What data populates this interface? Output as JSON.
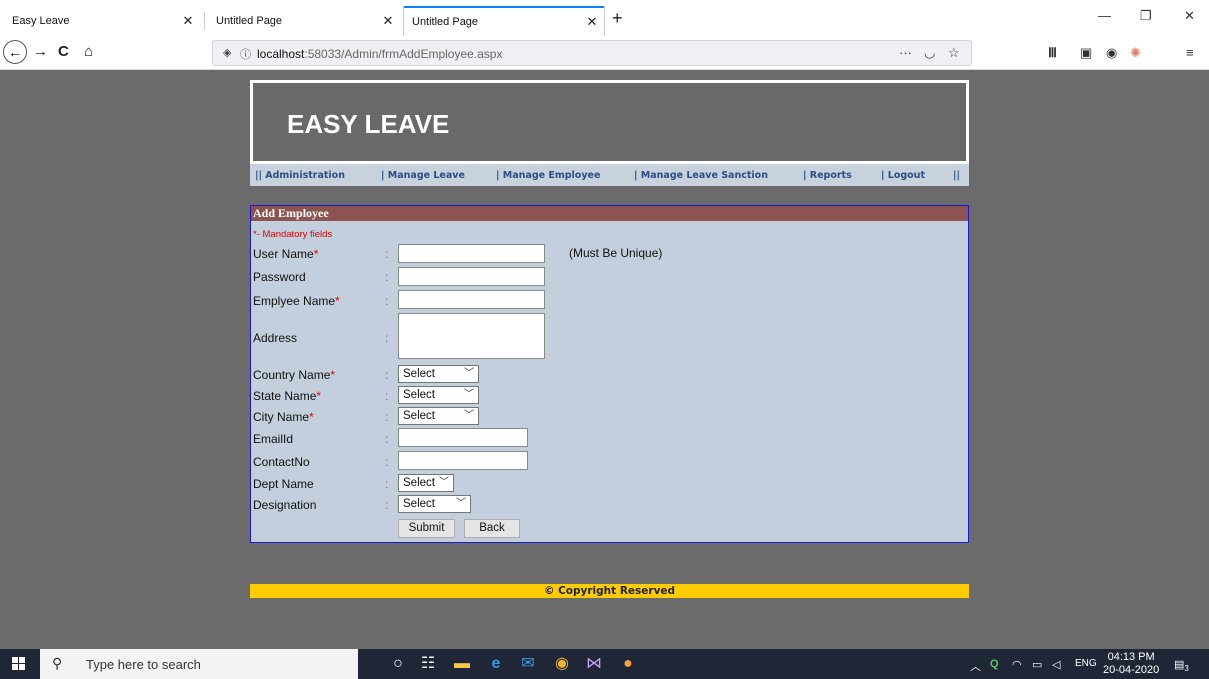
{
  "browser": {
    "tabs": [
      {
        "title": "Easy Leave"
      },
      {
        "title": "Untitled Page"
      },
      {
        "title": "Untitled Page"
      }
    ],
    "url_host": "localhost",
    "url_path": ":58033/Admin/frmAddEmployee.aspx",
    "more_icon": "···"
  },
  "site": {
    "title": "EASY LEAVE",
    "menu": [
      "||   Administration",
      "|   Manage Leave",
      "|   Manage Employee",
      "|   Manage Leave Sanction",
      "|   Reports",
      "|   Logout",
      "||"
    ]
  },
  "form": {
    "header": "Add Employee",
    "mandatory_note": "*- Mandatory fields",
    "colon": ":",
    "unique_note": "(Must Be Unique)",
    "fields": {
      "username": {
        "label": "User Name",
        "req": "*",
        "value": ""
      },
      "password": {
        "label": "Password",
        "value": ""
      },
      "empname": {
        "label": "Emplyee Name",
        "req": "*",
        "value": ""
      },
      "address": {
        "label": "Address",
        "value": ""
      },
      "country": {
        "label": "Country Name",
        "req": "*",
        "selected": "Select"
      },
      "state": {
        "label": "State Name",
        "req": "*",
        "selected": "Select"
      },
      "city": {
        "label": "City Name",
        "req": "*",
        "selected": "Select"
      },
      "email": {
        "label": "EmailId",
        "value": ""
      },
      "contact": {
        "label": "ContactNo",
        "value": ""
      },
      "dept": {
        "label": "Dept Name",
        "selected": "Select"
      },
      "designation": {
        "label": "Designation",
        "selected": "Select"
      }
    },
    "submit_label": "Submit",
    "back_label": "Back"
  },
  "footer": {
    "text": "© Copyright Reserved"
  },
  "taskbar": {
    "search_placeholder": "Type here to search",
    "lang": "ENG",
    "time": "04:13 PM",
    "date": "20-04-2020",
    "notifications": "3"
  }
}
